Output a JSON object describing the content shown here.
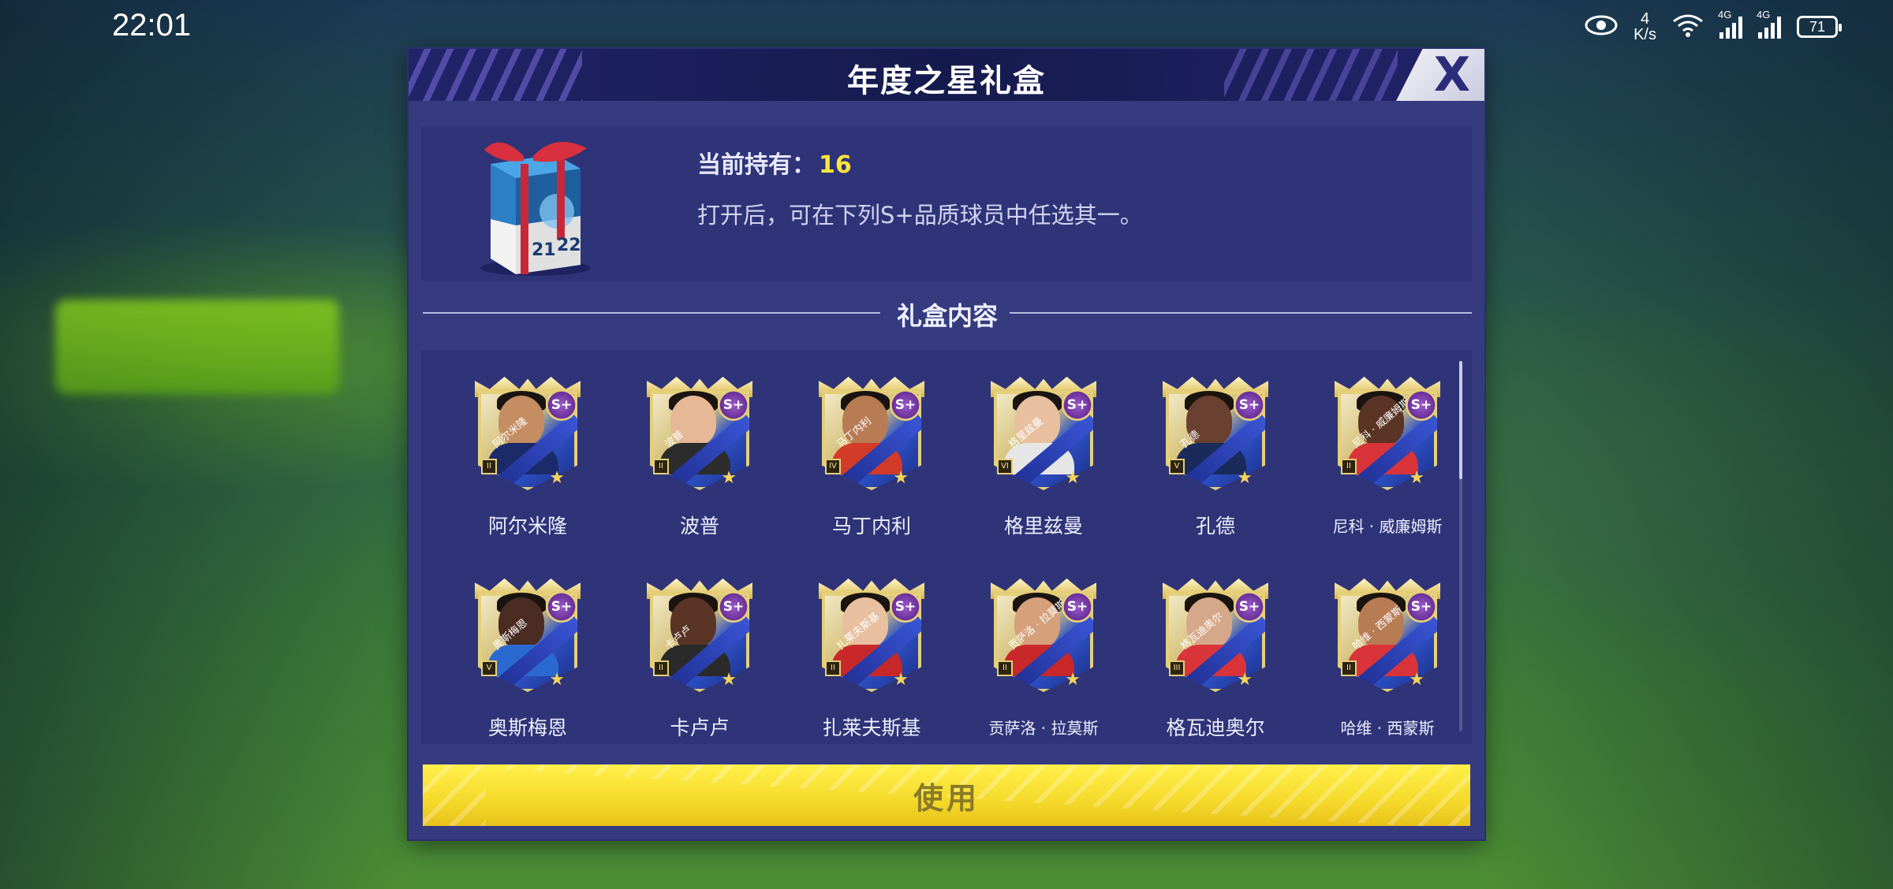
{
  "status_bar": {
    "time": "22:01",
    "net_speed_value": "4",
    "net_speed_unit": "K/s",
    "signal1_tag": "4G",
    "signal2_tag": "4G",
    "battery": "71"
  },
  "dialog": {
    "title": "年度之星礼盒",
    "close_label": "X",
    "owned_label": "当前持有：",
    "owned_count": "16",
    "description": "打开后，可在下列S+品质球员中任选其一。",
    "section_title": "礼盒内容",
    "use_button_label": "使用"
  },
  "players": [
    {
      "name": "阿尔米隆",
      "card_label": "阿尔米隆",
      "rank": "II",
      "skin": "#c58d62",
      "shirt": "#1b2b6a"
    },
    {
      "name": "波普",
      "card_label": "波普",
      "rank": "II",
      "skin": "#e6b896",
      "shirt": "#2c2c2c"
    },
    {
      "name": "马丁内利",
      "card_label": "马丁内利",
      "rank": "IV",
      "skin": "#b87c55",
      "shirt": "#d23a2a"
    },
    {
      "name": "格里兹曼",
      "card_label": "格里兹曼",
      "rank": "VI",
      "skin": "#e8c0a0",
      "shirt": "#e6e6e6"
    },
    {
      "name": "孔德",
      "card_label": "孔德",
      "rank": "V",
      "skin": "#6a4030",
      "shirt": "#1a2a5a"
    },
    {
      "name": "尼科 · 威廉姆斯",
      "card_label": "尼科 · 威廉姆斯",
      "rank": "II",
      "skin": "#5a3424",
      "shirt": "#d8343a"
    },
    {
      "name": "奥斯梅恩",
      "card_label": "奥斯梅恩",
      "rank": "V",
      "skin": "#4a2c22",
      "shirt": "#2a6ad0"
    },
    {
      "name": "卡卢卢",
      "card_label": "卡卢卢",
      "rank": "II",
      "skin": "#5a3424",
      "shirt": "#2a2a2a"
    },
    {
      "name": "扎莱夫斯基",
      "card_label": "扎莱夫斯基",
      "rank": "II",
      "skin": "#e8c0a0",
      "shirt": "#c8282a"
    },
    {
      "name": "贡萨洛 · 拉莫斯",
      "card_label": "贡萨洛 · 拉莫斯",
      "rank": "II",
      "skin": "#d6a07a",
      "shirt": "#c8282a"
    },
    {
      "name": "格瓦迪奥尔",
      "card_label": "格瓦迪奥尔",
      "rank": "III",
      "skin": "#d6a88a",
      "shirt": "#d8343a"
    },
    {
      "name": "哈维 · 西蒙斯",
      "card_label": "哈维 · 西蒙斯",
      "rank": "II",
      "skin": "#b87c55",
      "shirt": "#d8343a"
    }
  ],
  "colors": {
    "dialog_bg": "#363b7f",
    "panel_bg": "#2f3478",
    "accent_yellow": "#ffe63b",
    "button_yellow": "#f5d92a"
  },
  "icons": {
    "close": "close-icon",
    "gift": "gift-box-icon",
    "eye": "eye-icon",
    "wifi": "wifi-icon",
    "signal": "signal-icon",
    "battery": "battery-icon"
  }
}
